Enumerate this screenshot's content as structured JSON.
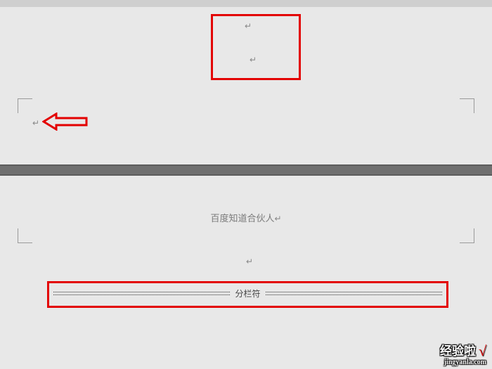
{
  "marks": {
    "pilcrow": "↵"
  },
  "page2": {
    "header_text": "百度知道合伙人",
    "column_break_label": "分栏符"
  },
  "watermark": {
    "line1": "经验啦",
    "check": "√",
    "line2": "jingyanla.com"
  },
  "annotations": {
    "top_box": "highlight-box",
    "arrow": "red-arrow-left",
    "break_box": "column-break-highlight"
  }
}
